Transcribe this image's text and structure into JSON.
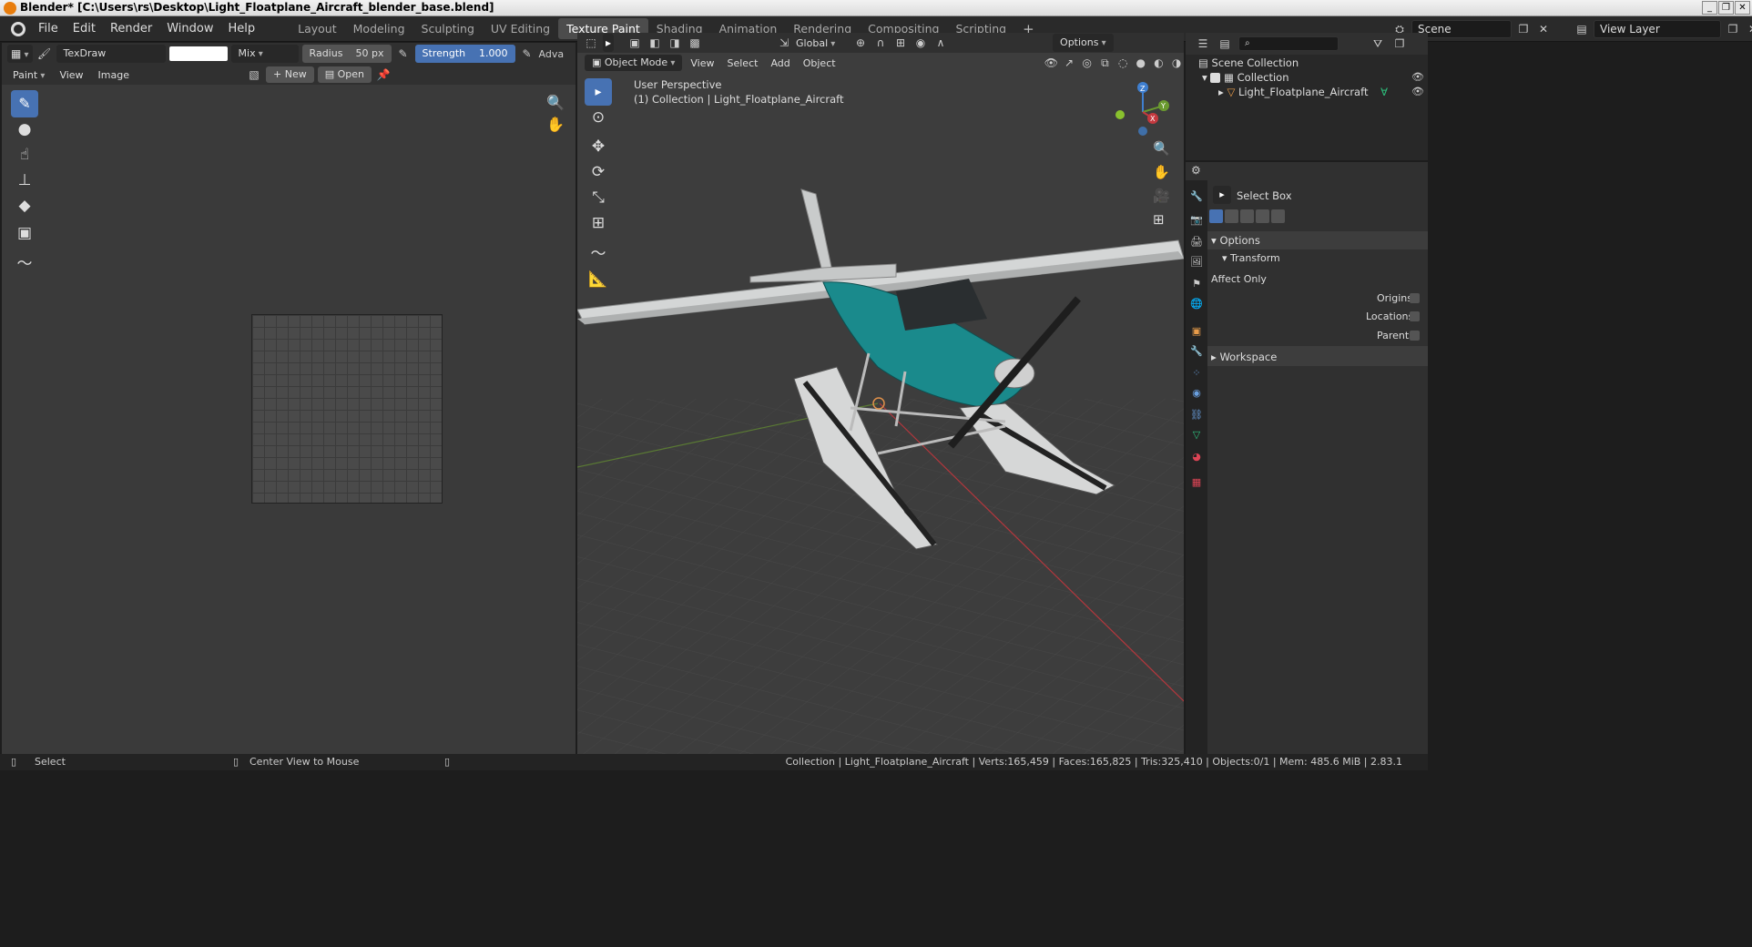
{
  "window": {
    "title": "Blender* [C:\\Users\\rs\\Desktop\\Light_Floatplane_Aircraft_blender_base.blend]",
    "controls": [
      "_",
      "❐",
      "✕"
    ]
  },
  "menu": [
    "File",
    "Edit",
    "Render",
    "Window",
    "Help"
  ],
  "workspaces": [
    "Layout",
    "Modeling",
    "Sculpting",
    "UV Editing",
    "Texture Paint",
    "Shading",
    "Animation",
    "Rendering",
    "Compositing",
    "Scripting"
  ],
  "active_workspace": "Texture Paint",
  "add_workspace": "+",
  "scene": {
    "name": "Scene",
    "view_layer": "View Layer"
  },
  "image_editor": {
    "brush_name": "TexDraw",
    "color_hex": "#ffffff",
    "blend_mode": "Mix",
    "radius_label": "Radius",
    "radius_value": "50 px",
    "strength_label": "Strength",
    "strength_value": "1.000",
    "strength_fraction": 1.0,
    "advanced_label": "Adva",
    "mode": "Paint",
    "menus": [
      "View",
      "Image"
    ],
    "new_label": "New",
    "open_label": "Open"
  },
  "viewport": {
    "mode": "Object Mode",
    "menus": [
      "View",
      "Select",
      "Add",
      "Object"
    ],
    "orientation": "Global",
    "options_label": "Options",
    "perspective_label": "User Perspective",
    "collection_label": "(1) Collection | Light_Floatplane_Aircraft",
    "gizmo": {
      "x": "X",
      "y": "Y",
      "z": "Z"
    },
    "colors": {
      "fuselage_accent": "#1a8a8c",
      "x_axis": "#c4393f",
      "y_axis": "#6a9a2f",
      "z_axis": "#3f7fd0"
    }
  },
  "outliner": {
    "scene_collection": "Scene Collection",
    "collection": "Collection",
    "object": "Light_Floatplane_Aircraft"
  },
  "properties": {
    "tool_name": "Select Box",
    "options_header": "Options",
    "transform_header": "Transform",
    "affect_only": "Affect Only",
    "origins": "Origins",
    "locations": "Locations",
    "parents": "Parents",
    "workspace_header": "Workspace"
  },
  "status": {
    "left_action": "Select",
    "mid_action": "Center View to Mouse",
    "stats": "Collection | Light_Floatplane_Aircraft | Verts:165,459 | Faces:165,825 | Tris:325,410 | Objects:0/1 | Mem: 485.6 MiB | 2.83.1"
  }
}
